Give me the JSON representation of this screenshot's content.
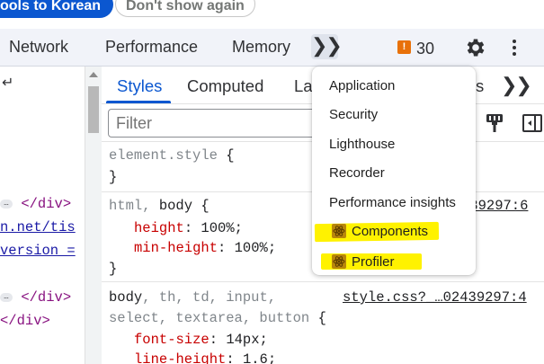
{
  "infobar": {
    "primary_button": "ools to Korean",
    "secondary_button": "Don't show again"
  },
  "devtools": {
    "tabs": [
      "Network",
      "Performance",
      "Memory"
    ],
    "more_tabs_icon": "double-chevron-right",
    "issues": {
      "icon": "issues-flag",
      "color": "#e8710a",
      "count": "30"
    },
    "settings_icon": "gear",
    "menu_icon": "kebab"
  },
  "elements_panel": {
    "arrow_glyph": "↵",
    "lines": [
      {
        "ellipsis": "…",
        "text": "</div>"
      },
      {
        "text": "n.net/tis"
      },
      {
        "text": "version_="
      },
      {
        "ellipsis": "…",
        "text": "</div>"
      },
      {
        "text": "</div>"
      }
    ]
  },
  "styles_panel": {
    "tabs": [
      "Styles",
      "Computed",
      "La",
      "s"
    ],
    "active_tab": "Styles",
    "filter_placeholder": "Filter",
    "rules": [
      {
        "selector": "element.style",
        "open": "{",
        "close": "}",
        "declarations": []
      },
      {
        "selector_gray": "html,",
        "selector_dark": "body",
        "open": "{",
        "close": "}",
        "source": "439297:6",
        "declarations": [
          {
            "prop": "height",
            "value": "100%;"
          },
          {
            "prop": "min-height",
            "value": "100%;"
          }
        ]
      },
      {
        "selector_dark": "body",
        "selector_gray": ", th, td, input,",
        "selector_line2": "select, textarea, button",
        "open": "{",
        "source": "style.css?_…02439297:4",
        "declarations": [
          {
            "prop": "font-size",
            "value": "14px;"
          },
          {
            "prop": "line-height",
            "value": "1.6;"
          }
        ]
      }
    ]
  },
  "more_tabs_menu": {
    "items": [
      {
        "label": "Application",
        "icon": null,
        "highlighted": false
      },
      {
        "label": "Security",
        "icon": null,
        "highlighted": false
      },
      {
        "label": "Lighthouse",
        "icon": null,
        "highlighted": false
      },
      {
        "label": "Recorder",
        "icon": null,
        "highlighted": false
      },
      {
        "label": "Performance insights",
        "icon": null,
        "highlighted": false
      },
      {
        "label": "Components",
        "icon": "react-extension",
        "highlighted": true
      },
      {
        "label": "Profiler",
        "icon": "react-extension",
        "highlighted": true
      }
    ],
    "highlight_color": "#fff200"
  }
}
